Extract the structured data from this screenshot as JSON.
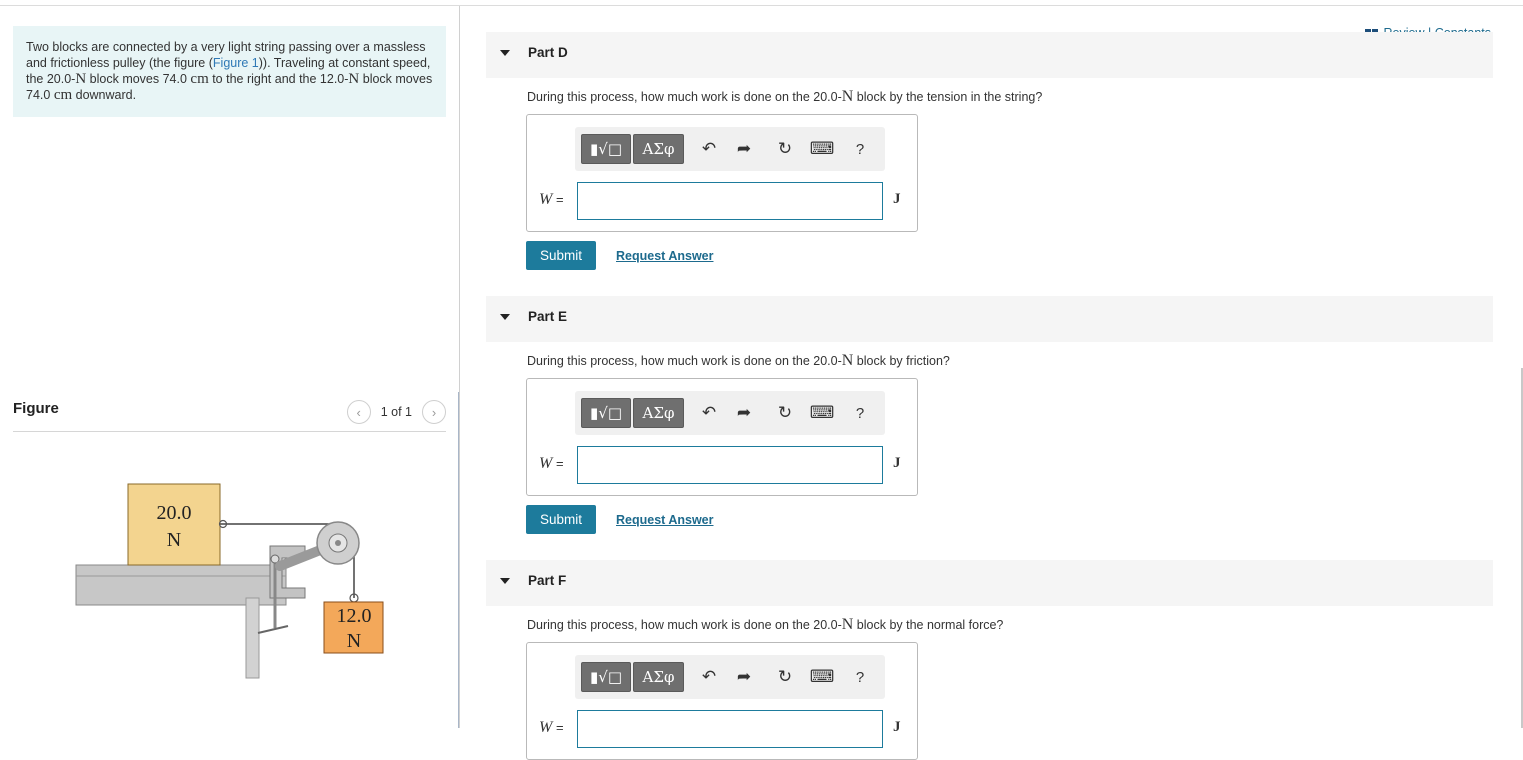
{
  "problem": {
    "pre_link": "Two blocks are connected by a very light string passing over a massless and frictionless pulley (the figure (",
    "figure_link": "Figure 1",
    "post_link_1": ")). Traveling at constant speed, the 20.0-",
    "unit_N_1": "N",
    "post_link_2": " block moves 74.0 ",
    "unit_cm_1": "cm",
    "post_link_3": " to the right and the 12.0-",
    "unit_N_2": "N",
    "post_link_4": " block moves 74.0 ",
    "unit_cm_2": "cm",
    "post_link_5": " downward."
  },
  "figure": {
    "title": "Figure",
    "pager_text": "1 of 1",
    "block_top_line1": "20.0",
    "block_top_line2": "N",
    "block_hanging_line1": "12.0",
    "block_hanging_line2": "N",
    "colors": {
      "block_top": "#f3d48f",
      "block_hanging": "#f3a85a",
      "table": "#c7c7c7"
    }
  },
  "header": {
    "review": "Review",
    "separator": " | ",
    "constants": "Constants"
  },
  "parts": [
    {
      "title": "Part D",
      "question_pre": "During this process, how much work is done on the 20.0-",
      "question_unit": "N",
      "question_post": " block by the tension in the string?",
      "variable": "W",
      "equals": " = ",
      "answer_value": "",
      "unit": "J",
      "submit": "Submit",
      "request": "Request Answer"
    },
    {
      "title": "Part E",
      "question_pre": "During this process, how much work is done on the 20.0-",
      "question_unit": "N",
      "question_post": " block by friction?",
      "variable": "W",
      "equals": " = ",
      "answer_value": "",
      "unit": "J",
      "submit": "Submit",
      "request": "Request Answer"
    },
    {
      "title": "Part F",
      "question_pre": "During this process, how much work is done on the 20.0-",
      "question_unit": "N",
      "question_post": " block by the normal force?",
      "variable": "W",
      "equals": " = ",
      "answer_value": "",
      "unit": "J"
    }
  ],
  "toolbar": {
    "templates_icon": "templates-icon",
    "greek_label": "ΑΣφ",
    "undo_icon": "undo-icon",
    "redo_icon": "redo-icon",
    "reset_icon": "reset-icon",
    "keyboard_icon": "keyboard-icon",
    "help_label": "?"
  },
  "colors": {
    "accent": "#1d7b9c",
    "link": "#1d6a8d",
    "problem_bg": "#e8f5f6"
  }
}
